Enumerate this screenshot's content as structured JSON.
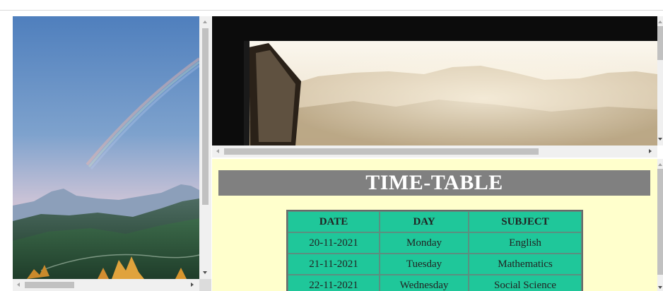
{
  "timetable": {
    "heading": "TIME-TABLE",
    "columns": [
      "DATE",
      "DAY",
      "SUBJECT"
    ],
    "rows": [
      [
        "20-11-2021",
        "Monday",
        "English"
      ],
      [
        "21-11-2021",
        "Tuesday",
        "Mathematics"
      ],
      [
        "22-11-2021",
        "Wednesday",
        "Social Science"
      ]
    ]
  },
  "images": {
    "left": "mountain-rainbow-landscape",
    "top": "open-window-misty-hills"
  },
  "colors": {
    "page_bg": "#ffffcc",
    "banner_bg": "#808080",
    "table_bg": "#1fc79a"
  }
}
